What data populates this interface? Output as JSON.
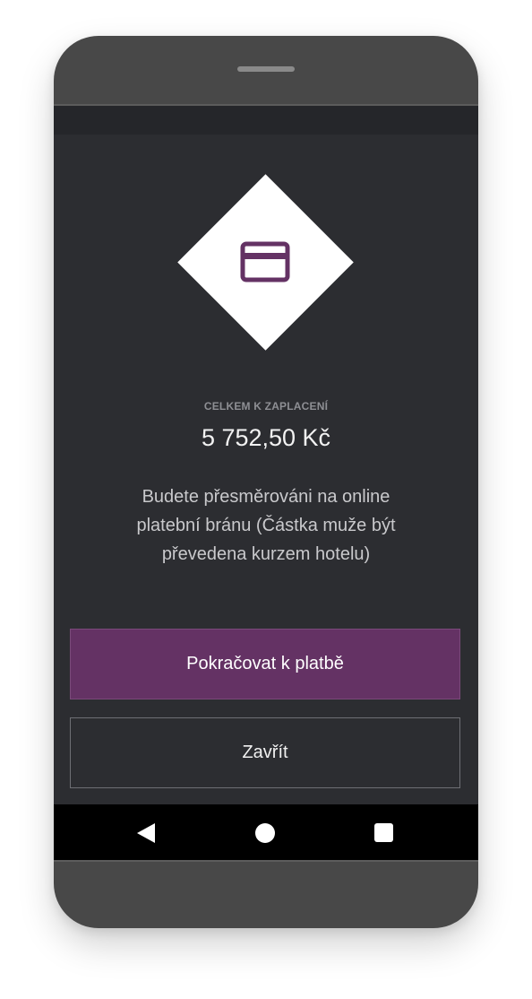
{
  "payment": {
    "total_label": "CELKEM K ZAPLACENÍ",
    "total_amount": "5 752,50 Kč",
    "note": "Budete přesměrováni na online platební bránu (Částka muže být převedena kurzem hotelu)",
    "icon": "credit-card-icon"
  },
  "actions": {
    "pay_label": "Pokračovat k platbě",
    "close_label": "Zavřít"
  },
  "navigation": {
    "back_icon": "back-triangle-icon",
    "home_icon": "home-circle-icon",
    "recents_icon": "recents-square-icon"
  },
  "colors": {
    "accent": "#643264",
    "background": "#2c2d31",
    "device": "#484848"
  }
}
